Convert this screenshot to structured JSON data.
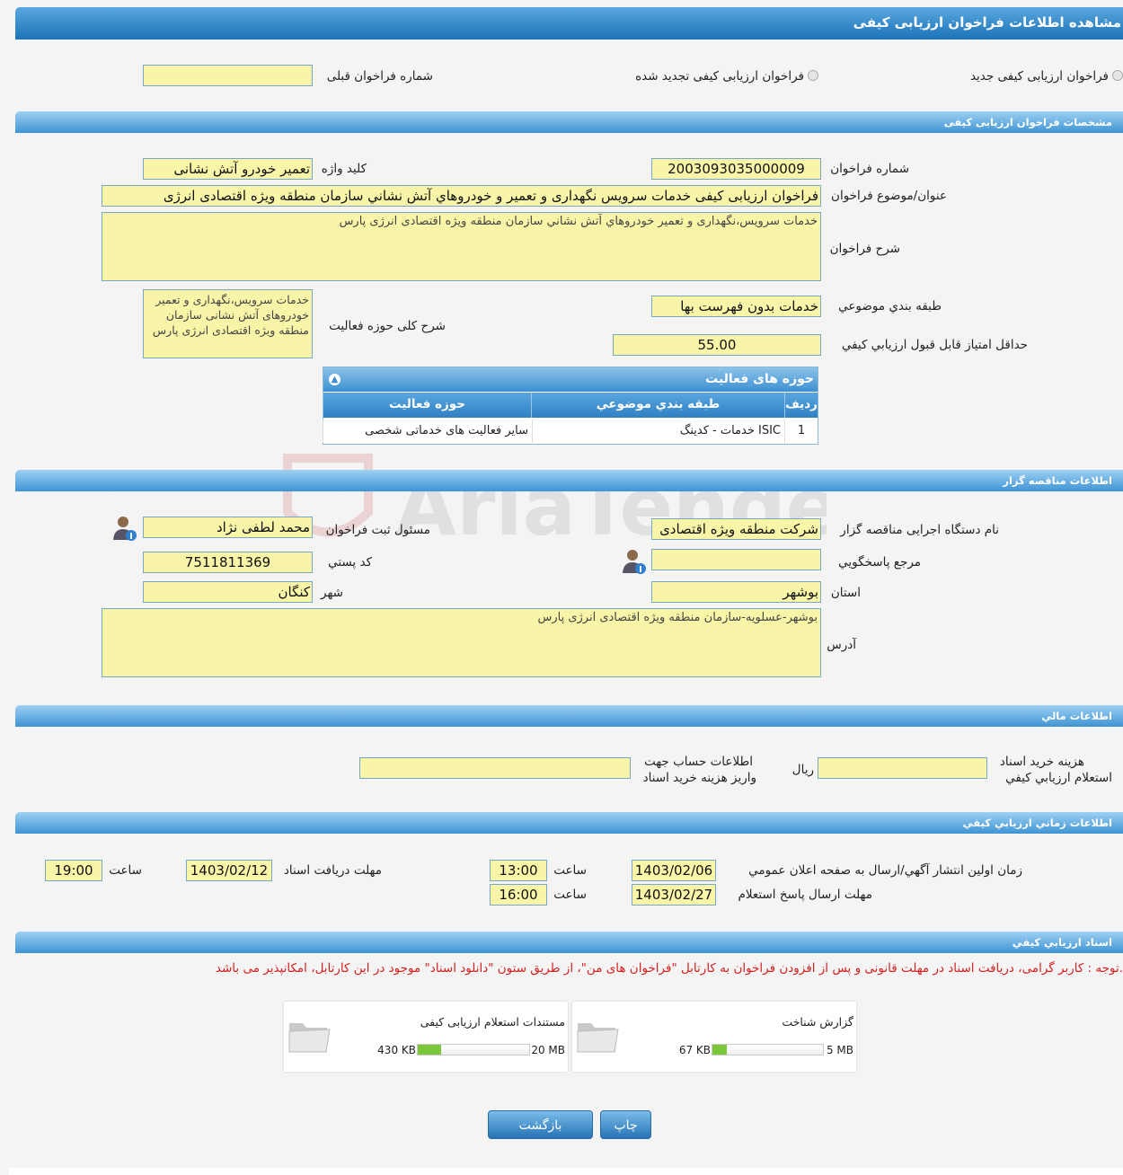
{
  "header": {
    "title": "مشاهده اطلاعات فراخوان ارزیابی کیفی"
  },
  "type_options": {
    "new": "فراخوان ارزیابی کیفی جدید",
    "renewed": "فراخوان ارزیابی کیفی تجدید شده",
    "prev_number_label": "شماره فراخوان قبلی",
    "prev_number_value": ""
  },
  "specs": {
    "section_title": "مشخصات فراخوان ارزیابی کیفی",
    "number_label": "شماره فراخوان",
    "number_value": "2003093035000009",
    "keyword_label": "کلید واژه",
    "keyword_value": "تعمیر خودرو آتش نشانی",
    "title_label": "عنوان/موضوع فراخوان",
    "title_value": "فراخوان ارزیابی کیفی خدمات سرویس نگهداری و تعمیر و خودروهاي آتش نشاني سازمان منطقه ويژه اقتصادی انرژی",
    "desc_label": "شرح فراخوان",
    "desc_value": "خدمات سرويس،نگهداری و تعمير خودروهاي آتش نشاني سازمان منطقه ويژه اقتصادی انرژی پارس",
    "category_label": "طبقه بندي موضوعي",
    "category_value": "خدمات بدون فهرست بها",
    "activity_desc_label": "شرح کلی حوزه فعالیت",
    "activity_desc_value": "خدمات سرويس،نگهداری و تعمير خودروهای آتش نشانی سازمان منطقه ويژه اقتصادی انرژی پارس",
    "min_score_label": "حداقل امتياز قابل قبول ارزيابي کيفي",
    "min_score_value": "55.00"
  },
  "activity_grid": {
    "title": "حوزه های فعالیت",
    "columns": [
      "ردیف",
      "طبقه بندي موضوعي",
      "حوزه فعالیت"
    ],
    "rows": [
      [
        "1",
        "خدمات - کدینگ ISIC",
        "سایر فعالیت های خدماتی شخصی"
      ]
    ]
  },
  "tenderer": {
    "section_title": "اطلاعات مناقصه گزار",
    "org_label": "نام دستگاه اجرایی مناقصه گزار",
    "org_value": "شرکت منطقه ویژه اقتصادی",
    "responsible_label": "مسئول ثبت فراخوان",
    "responsible_value": "محمد لطفی نژاد",
    "reference_label": "مرجع پاسخگويي",
    "reference_value": "",
    "postal_label": "کد پستي",
    "postal_value": "7511811369",
    "province_label": "استان",
    "province_value": "بوشهر",
    "city_label": "شهر",
    "city_value": "کنگان",
    "address_label": "آدرس",
    "address_value": "بوشهر-عسلويه-سازمان منطقه ويژه اقتصادی انرژی پارس"
  },
  "financial": {
    "section_title": "اطلاعات مالي",
    "cost_label_1": "هزينه خريد اسناد",
    "cost_label_2": "استعلام ارزيابي کيفي",
    "cost_value": "",
    "currency": "ريال",
    "account_label_1": "اطلاعات حساب جهت",
    "account_label_2": "واریز هزینه خرید اسناد",
    "account_value": ""
  },
  "timing": {
    "section_title": "اطلاعات زماني ارزيابي کيفي",
    "publish_label": "زمان اولين انتشار آگهي/ارسال به صفحه اعلان عمومي",
    "publish_date": "1403/02/06",
    "publish_time": "13:00",
    "receive_label": "مهلت دريافت اسناد",
    "receive_date": "1403/02/12",
    "receive_time": "19:00",
    "answer_label": "مهلت ارسال پاسخ استعلام",
    "answer_date": "1403/02/27",
    "answer_time": "16:00",
    "time_label": "ساعت"
  },
  "documents": {
    "section_title": "اسناد ارزيابي کيفي",
    "notice": "توجه : کاربر گرامی، دریافت اسناد در مهلت قانونی و پس از افزودن فراخوان به کارتابل \"فراخوان های من\"، از طریق ستون \"دانلود اسناد\" موجود در این کارتابل، امکانپذیر می باشد.",
    "items": [
      {
        "name": "گزارش شناخت",
        "size": "67 KB",
        "max": "5 MB",
        "fill": 0.013
      },
      {
        "name": "مستندات استعلام ارزیابی کیفی",
        "size": "430 KB",
        "max": "20 MB",
        "fill": 0.021
      }
    ]
  },
  "actions": {
    "print": "چاپ",
    "back": "بازگشت"
  },
  "watermark": "AriaTender.neT"
}
